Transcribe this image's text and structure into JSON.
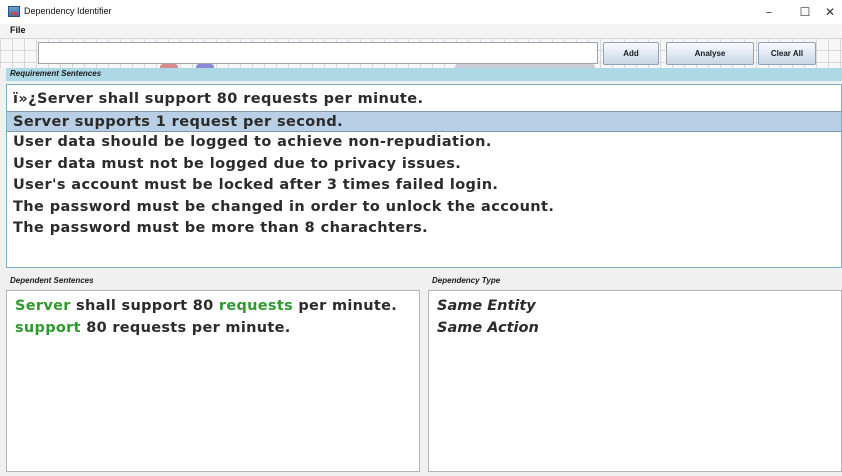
{
  "window": {
    "title": "Dependency Identifier",
    "minimize_glyph": "–",
    "maximize_glyph": "☐",
    "close_glyph": "✕"
  },
  "menu": {
    "file": "File"
  },
  "toolbar": {
    "input_value": "",
    "add_label": "Add",
    "analyse_label": "Analyse",
    "clear_label": "Clear All"
  },
  "requirements": {
    "label": "Requirement Sentences",
    "selected_index": 1,
    "items": [
      "ï»¿Server shall support 80 requests per minute.",
      "Server supports 1 request per second.",
      "User data should be logged to achieve non-repudiation.",
      "User data must not be logged due to privacy issues.",
      "User's account must be locked after 3 times failed login.",
      "The password must be changed in order to unlock the account.",
      "The password must be more than 8 charachters."
    ]
  },
  "dependent": {
    "label": "Dependent Sentences",
    "line1": {
      "w1": "Server",
      "t1": " shall support 80 ",
      "w2": "requests",
      "t2": " per minute."
    },
    "line2": {
      "w1": "support",
      "t1": " 80 requests per minute."
    }
  },
  "dependency_type": {
    "label": "Dependency Type",
    "items": [
      "Same Entity",
      "Same Action"
    ]
  },
  "colors": {
    "highlight": "#2e9a2e",
    "selection": "#b8cfe5",
    "label_bar": "#add8e6"
  }
}
